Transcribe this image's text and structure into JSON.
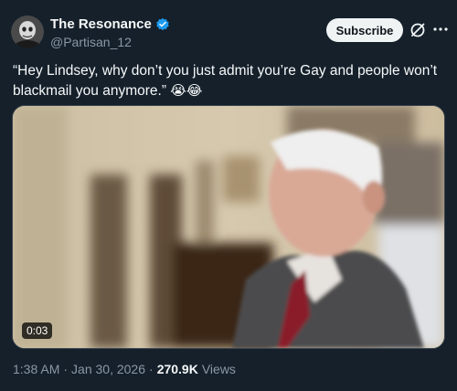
{
  "author": {
    "display_name": "The Resonance",
    "handle": "@Partisan_12",
    "verified_icon": "verified-badge-icon",
    "verified_color": "#1d9bf0"
  },
  "actions": {
    "subscribe_label": "Subscribe",
    "grok_icon": "grok-slash-icon",
    "more_icon": "more-dots-icon"
  },
  "tweet": {
    "text": "“Hey Lindsey, why don’t you just admit you’re Gay and people won’t blackmail you anymore.”",
    "emojis": "😭😂"
  },
  "media": {
    "type": "video",
    "duration": "0:03"
  },
  "meta": {
    "time": "1:38 AM",
    "date": "Jan 30, 2026",
    "separator": "·",
    "views_count": "270.9K",
    "views_label": "Views"
  },
  "colors": {
    "background": "#15202b",
    "text": "#f7f9f9",
    "secondary": "#8b98a5",
    "accent": "#1d9bf0"
  }
}
